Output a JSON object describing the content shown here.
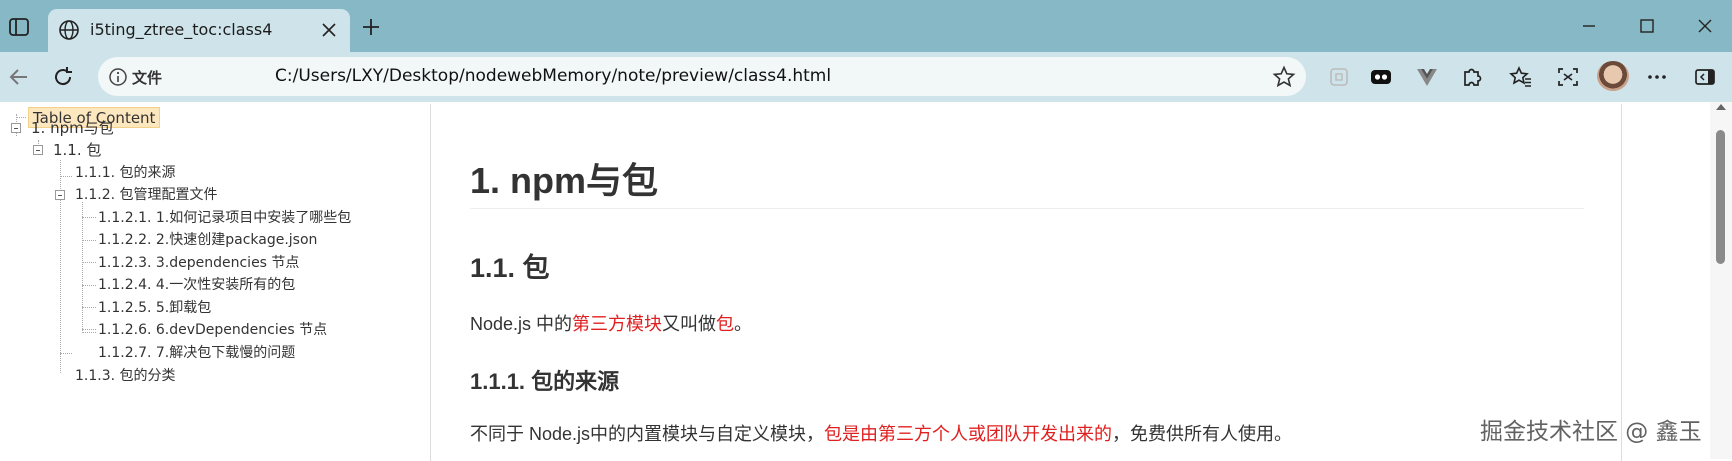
{
  "tab": {
    "title": "i5ting_ztree_toc:class4",
    "close_icon": "close-icon",
    "globe_icon": "globe-icon"
  },
  "address_bar": {
    "scheme_label": "文件",
    "url": "C:/Users/LXY/Desktop/nodewebMemory/note/preview/class4.html"
  },
  "toolbar_icons": [
    "back-icon",
    "refresh-icon",
    "info-icon",
    "star-icon",
    "extension-square-icon",
    "tracking-icon",
    "vue-icon",
    "puzzle-icon",
    "favorites-icon",
    "screenshot-icon",
    "profile-icon",
    "more-icon",
    "sidebar-icon"
  ],
  "toc": {
    "header": "Table of Content",
    "items": [
      {
        "label": "1. npm与包"
      },
      {
        "label": "1.1. 包"
      },
      {
        "label": "1.1.1. 包的来源"
      },
      {
        "label": "1.1.2. 包管理配置文件"
      },
      {
        "label": "1.1.2.1. 1.如何记录项目中安装了哪些包"
      },
      {
        "label": "1.1.2.2. 2.快速创建package.json"
      },
      {
        "label": "1.1.2.3. 3.dependencies 节点"
      },
      {
        "label": "1.1.2.4. 4.一次性安装所有的包"
      },
      {
        "label": "1.1.2.5. 5.卸载包"
      },
      {
        "label": "1.1.2.6. 6.devDependencies 节点"
      },
      {
        "label": "1.1.2.7. 7.解决包下载慢的问题"
      },
      {
        "label": "1.1.3. 包的分类"
      }
    ]
  },
  "doc": {
    "h1": "1. npm与包",
    "h2": "1.1. 包",
    "p1": {
      "a": "Node.js 中的",
      "b": "第三方模块",
      "c": "又叫做",
      "d": "包",
      "e": "。"
    },
    "h3": "1.1.1. 包的来源",
    "p2": {
      "a": "不同于 Node.js中的内置模块与自定义模块，",
      "b": "包是由第三方个人或团队开发出来的",
      "c": "，免费供所有人使用。"
    }
  },
  "watermark": "掘金技术社区 @ 鑫玉",
  "colors": {
    "tabbar": "#86b9c5",
    "toolbar": "#cfe4ea",
    "highlight": "#e02020",
    "toc_header_bg": "#fde7bf"
  }
}
